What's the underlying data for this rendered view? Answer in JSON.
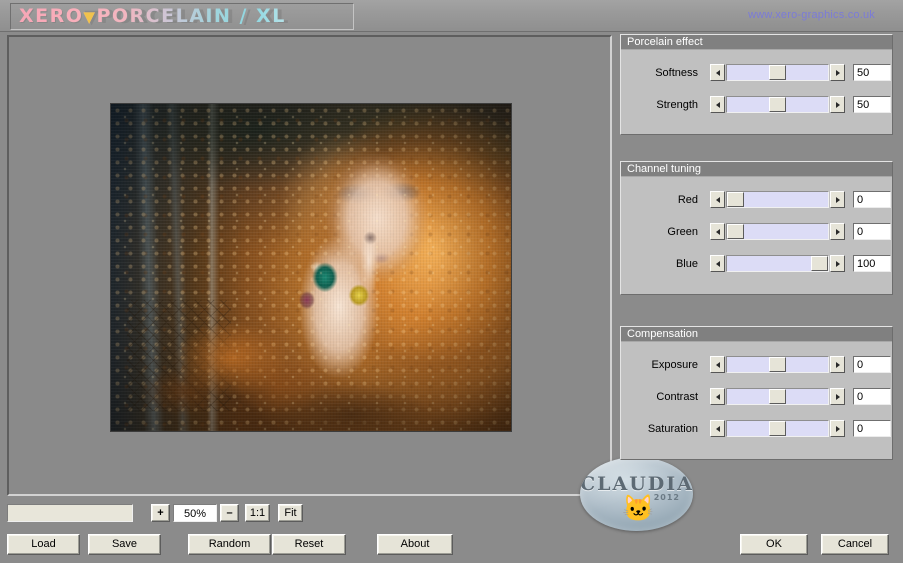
{
  "titlebar": {
    "brand_part1": "XERO",
    "brand_separator": "▼",
    "brand_part2": "PORCELAIN / XL",
    "brand_full": "XERO ▼ PORCELAIN / XL",
    "site_url": "www.xero-graphics.co.uk"
  },
  "watermark": {
    "text": "CLAUDIA",
    "year": "2012",
    "figure_icon": "cat-figure"
  },
  "zoombar": {
    "progress_value": "",
    "zoom_in_label": "+",
    "zoom_value": "50%",
    "zoom_out_label": "–",
    "actual_size_label": "1:1",
    "fit_label": "Fit"
  },
  "buttons": {
    "load": "Load",
    "save": "Save",
    "random": "Random",
    "reset": "Reset",
    "about": "About",
    "ok": "OK",
    "cancel": "Cancel"
  },
  "groups": [
    {
      "title": "Porcelain effect",
      "rows": [
        {
          "label": "Softness",
          "value": "50",
          "min": 0,
          "max": 100,
          "percent": 50
        },
        {
          "label": "Strength",
          "value": "50",
          "min": 0,
          "max": 100,
          "percent": 50
        }
      ]
    },
    {
      "title": "Channel tuning",
      "rows": [
        {
          "label": "Red",
          "value": "0",
          "min": 0,
          "max": 100,
          "percent": 0
        },
        {
          "label": "Green",
          "value": "0",
          "min": 0,
          "max": 100,
          "percent": 0
        },
        {
          "label": "Blue",
          "value": "100",
          "min": 0,
          "max": 100,
          "percent": 100
        }
      ]
    },
    {
      "title": "Compensation",
      "rows": [
        {
          "label": "Exposure",
          "value": "0",
          "min": -100,
          "max": 100,
          "percent": 50
        },
        {
          "label": "Contrast",
          "value": "0",
          "min": -100,
          "max": 100,
          "percent": 50
        },
        {
          "label": "Saturation",
          "value": "0",
          "min": -100,
          "max": 100,
          "percent": 50
        }
      ]
    }
  ],
  "colors": {
    "window_background": "#8b8b8b",
    "panel_face": "#c0c0c0",
    "group_header": "#808080",
    "slider_track": "#dcdcf6",
    "button_face": "#e6e4d8",
    "url_text": "#7b7bd8",
    "brand_pink": "#f7a6b6",
    "brand_cyan": "#8fd8e2",
    "brand_accent": "#f0c24d"
  }
}
